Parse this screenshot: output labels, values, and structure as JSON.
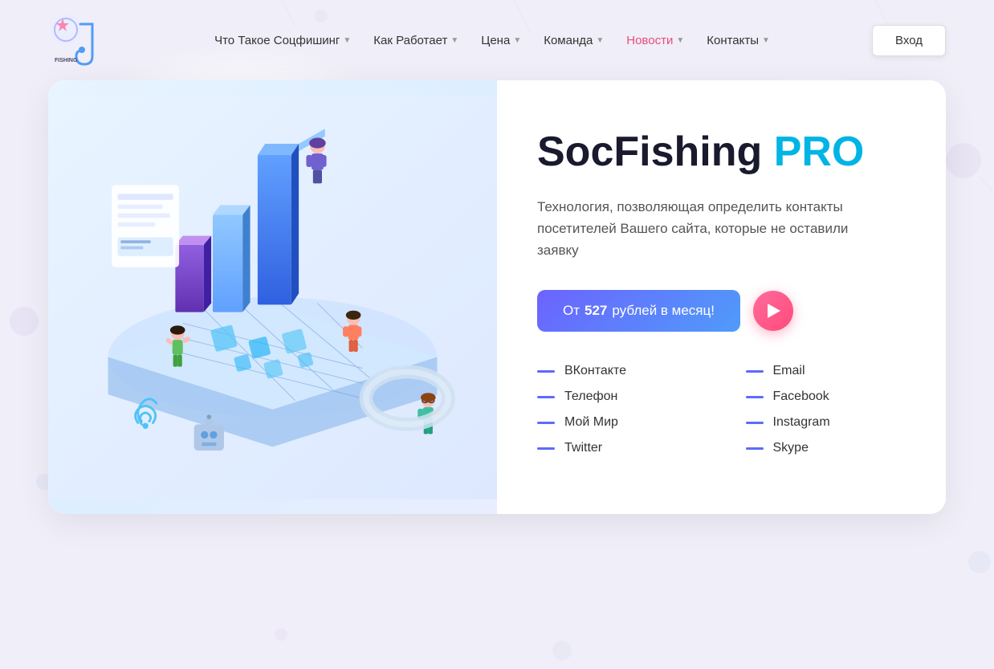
{
  "meta": {
    "title": "SocFishing PRO"
  },
  "navbar": {
    "logo_alt": "SocFishing Logo",
    "links": [
      {
        "id": "what",
        "label": "Что Такое Соцфишинг",
        "has_dropdown": true,
        "active": false
      },
      {
        "id": "how",
        "label": "Как Работает",
        "has_dropdown": true,
        "active": false
      },
      {
        "id": "price",
        "label": "Цена",
        "has_dropdown": true,
        "active": false
      },
      {
        "id": "team",
        "label": "Команда",
        "has_dropdown": true,
        "active": false
      },
      {
        "id": "news",
        "label": "Новости",
        "has_dropdown": true,
        "active": true
      },
      {
        "id": "contacts",
        "label": "Контакты",
        "has_dropdown": true,
        "active": false
      }
    ],
    "login_button": "Вход"
  },
  "hero": {
    "title_part1": "SocFishing ",
    "title_part2": "PRO",
    "subtitle": "Технология, позволяющая определить контакты посетителей Вашего сайта, которые не оставили заявку",
    "cta_button": {
      "prefix": "От ",
      "price": "527",
      "suffix": " рублей в месяц!"
    },
    "contacts_left": [
      {
        "id": "vk",
        "label": "ВКонтакте"
      },
      {
        "id": "phone",
        "label": "Телефон"
      },
      {
        "id": "mymailru",
        "label": "Мой Мир"
      },
      {
        "id": "twitter",
        "label": "Twitter"
      }
    ],
    "contacts_right": [
      {
        "id": "email",
        "label": "Email"
      },
      {
        "id": "facebook",
        "label": "Facebook"
      },
      {
        "id": "instagram",
        "label": "Instagram"
      },
      {
        "id": "skype",
        "label": "Skype"
      }
    ]
  },
  "colors": {
    "accent_blue": "#00b4e4",
    "accent_pink": "#ff4b7a",
    "accent_purple": "#6c63ff",
    "nav_active": "#e74c7c",
    "dash_color": "#5b6cf9"
  }
}
